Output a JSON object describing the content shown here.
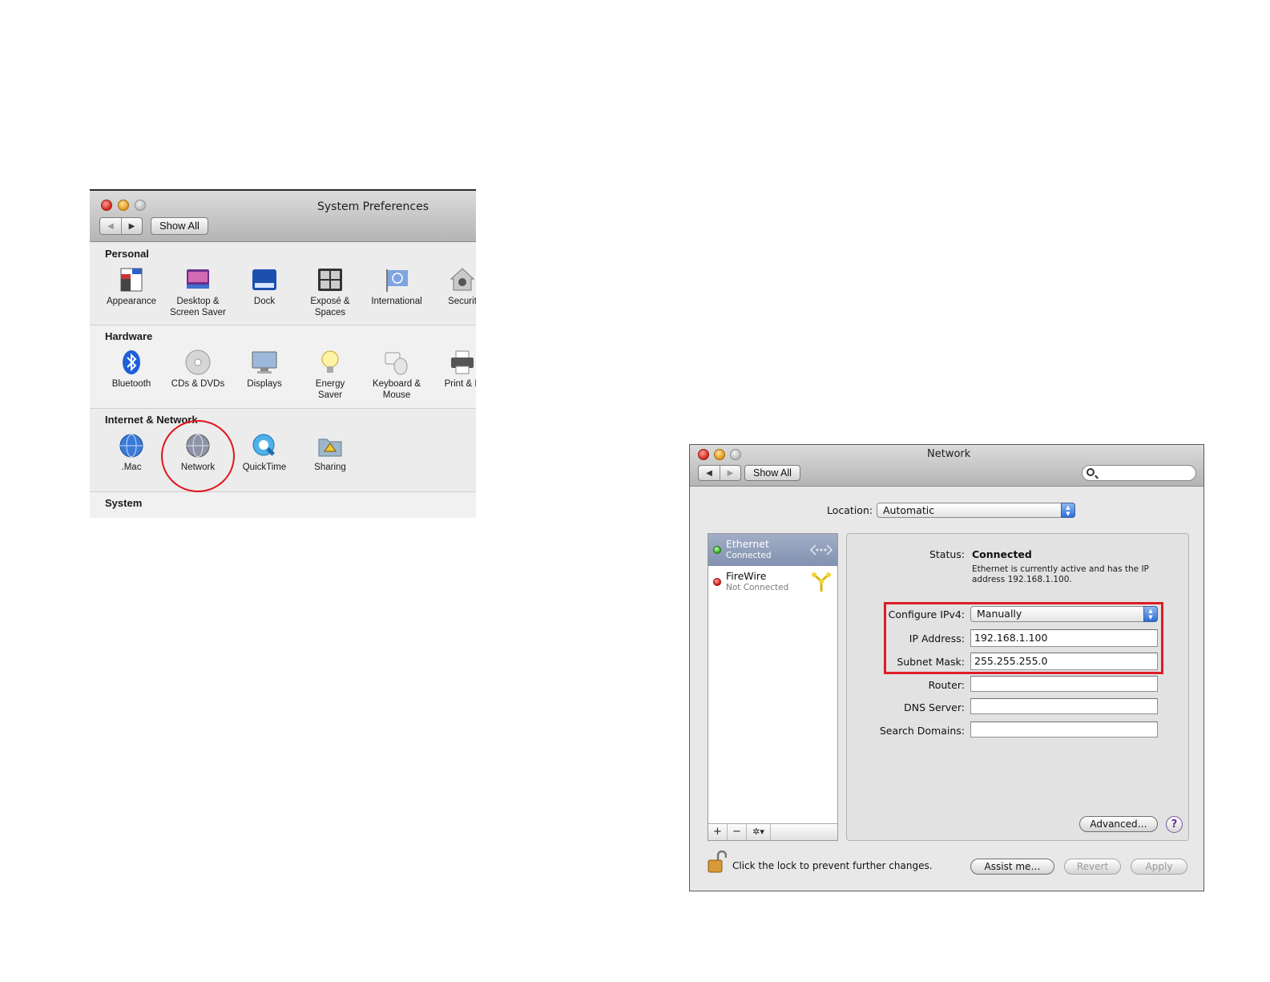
{
  "system_preferences": {
    "title": "System Preferences",
    "show_all": "Show All",
    "sections": [
      {
        "heading": "Personal",
        "items": [
          "Appearance",
          "Desktop &\nScreen Saver",
          "Dock",
          "Exposé &\nSpaces",
          "International",
          "Securit"
        ]
      },
      {
        "heading": "Hardware",
        "items": [
          "Bluetooth",
          "CDs & DVDs",
          "Displays",
          "Energy\nSaver",
          "Keyboard &\nMouse",
          "Print & F"
        ]
      },
      {
        "heading": "Internet & Network",
        "items": [
          ".Mac",
          "Network",
          "QuickTime",
          "Sharing"
        ]
      },
      {
        "heading": "System",
        "items": []
      }
    ],
    "icons": {
      "Appearance": "file-new-icon",
      "Desktop & Screen Saver": "desktop-icon",
      "Dock": "dock-icon",
      "Exposé & Spaces": "grid-icon",
      "International": "flag-icon",
      "Security": "house-lock-icon",
      "Bluetooth": "bluetooth-icon",
      "CDs & DVDs": "disc-icon",
      "Displays": "monitor-icon",
      "Energy Saver": "lightbulb-icon",
      "Keyboard & Mouse": "keyboard-mouse-icon",
      "Print & Fax": "printer-icon",
      ".Mac": "globe-icon",
      "Network": "network-globe-icon",
      "QuickTime": "quicktime-icon",
      "Sharing": "sharing-folder-icon"
    }
  },
  "network": {
    "title": "Network",
    "show_all": "Show All",
    "search_placeholder": "",
    "location_label": "Location:",
    "location_value": "Automatic",
    "services": [
      {
        "name": "Ethernet",
        "status": "Connected",
        "selected": true,
        "status_color": "#2ea41a",
        "icon": "ethernet-icon"
      },
      {
        "name": "FireWire",
        "status": "Not Connected",
        "selected": false,
        "status_color": "#d01717",
        "icon": "firewire-icon"
      }
    ],
    "list_toolbar": {
      "add": "+",
      "remove": "−",
      "gear": "✲▾"
    },
    "status_label": "Status:",
    "status_value": "Connected",
    "status_desc": "Ethernet is currently active and has the IP address 192.168.1.100.",
    "fields": [
      {
        "label": "Configure IPv4:",
        "value": "Manually",
        "type": "popup"
      },
      {
        "label": "IP Address:",
        "value": "192.168.1.100",
        "type": "text"
      },
      {
        "label": "Subnet Mask:",
        "value": "255.255.255.0",
        "type": "text"
      },
      {
        "label": "Router:",
        "value": "",
        "type": "text"
      },
      {
        "label": "DNS Server:",
        "value": "",
        "type": "text"
      },
      {
        "label": "Search Domains:",
        "value": "",
        "type": "text"
      }
    ],
    "advanced_button": "Advanced…",
    "help_button": "?",
    "lock_text": "Click the lock to prevent further changes.",
    "assist_button": "Assist me…",
    "revert_button": "Revert",
    "apply_button": "Apply"
  },
  "colors": {
    "highlight_red": "#dc1d26",
    "selection_blue": "#8191b0",
    "popup_blue": "#2d6fd8"
  }
}
